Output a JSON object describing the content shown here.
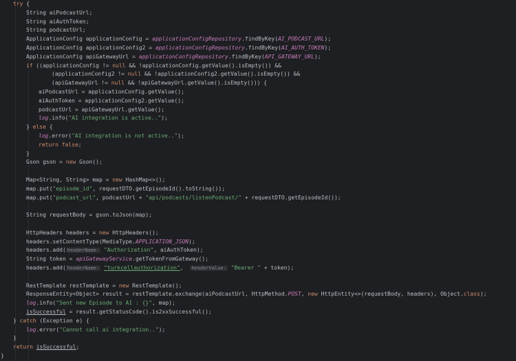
{
  "editor": {
    "lines": [
      {
        "x": 19,
        "tokens": [
          {
            "t": "try",
            "c": "kw"
          },
          {
            "t": " {",
            "c": ""
          }
        ]
      },
      {
        "x": 38,
        "tokens": [
          {
            "t": "String aiPodcastUrl;",
            "c": ""
          }
        ]
      },
      {
        "x": 38,
        "tokens": [
          {
            "t": "String aiAuthToken;",
            "c": ""
          }
        ]
      },
      {
        "x": 38,
        "tokens": [
          {
            "t": "String podcastUrl;",
            "c": ""
          }
        ]
      },
      {
        "x": 38,
        "tokens": [
          {
            "t": "ApplicationConfig applicationConfig = ",
            "c": ""
          },
          {
            "t": "applicationConfigRepository",
            "c": "fld"
          },
          {
            "t": ".findByKey(",
            "c": ""
          },
          {
            "t": "AI_PODCAST_URL",
            "c": "fld"
          },
          {
            "t": ");",
            "c": ""
          }
        ]
      },
      {
        "x": 38,
        "tokens": [
          {
            "t": "ApplicationConfig applicationConfig2 = ",
            "c": ""
          },
          {
            "t": "applicationConfigRepository",
            "c": "fld"
          },
          {
            "t": ".findByKey(",
            "c": ""
          },
          {
            "t": "AI_AUTH_TOKEN",
            "c": "fld"
          },
          {
            "t": ");",
            "c": ""
          }
        ]
      },
      {
        "x": 38,
        "tokens": [
          {
            "t": "ApplicationConfig apiGatewayUrl = ",
            "c": ""
          },
          {
            "t": "applicationConfigRepository",
            "c": "fld"
          },
          {
            "t": ".findByKey(",
            "c": ""
          },
          {
            "t": "API_GATEWAY_URL",
            "c": "fld"
          },
          {
            "t": ");",
            "c": ""
          }
        ]
      },
      {
        "x": 38,
        "tokens": [
          {
            "t": "if",
            "c": "kw"
          },
          {
            "t": " ((applicationConfig != ",
            "c": ""
          },
          {
            "t": "null",
            "c": "kw"
          },
          {
            "t": " && !applicationConfig.getValue().isEmpty()) &&",
            "c": ""
          }
        ]
      },
      {
        "x": 75,
        "tokens": [
          {
            "t": "(applicationConfig2 != ",
            "c": ""
          },
          {
            "t": "null",
            "c": "kw"
          },
          {
            "t": " && !applicationConfig2.getValue().isEmpty()) &&",
            "c": ""
          }
        ]
      },
      {
        "x": 75,
        "tokens": [
          {
            "t": "(apiGatewayUrl != ",
            "c": ""
          },
          {
            "t": "null",
            "c": "kw"
          },
          {
            "t": " && !apiGatewayUrl.getValue().isEmpty())) {",
            "c": ""
          }
        ]
      },
      {
        "x": 56,
        "tokens": [
          {
            "t": "aiPodcastUrl = applicationConfig.getValue();",
            "c": ""
          }
        ]
      },
      {
        "x": 56,
        "tokens": [
          {
            "t": "aiAuthToken = applicationConfig2.getValue();",
            "c": ""
          }
        ]
      },
      {
        "x": 56,
        "tokens": [
          {
            "t": "podcastUrl = apiGatewayUrl.getValue();",
            "c": ""
          }
        ]
      },
      {
        "x": 56,
        "tokens": [
          {
            "t": "log",
            "c": "fld"
          },
          {
            "t": ".info(",
            "c": ""
          },
          {
            "t": "\"AI integration is active..\"",
            "c": "str"
          },
          {
            "t": ");",
            "c": ""
          }
        ]
      },
      {
        "x": 38,
        "tokens": [
          {
            "t": "} ",
            "c": ""
          },
          {
            "t": "else",
            "c": "kw"
          },
          {
            "t": " {",
            "c": ""
          }
        ]
      },
      {
        "x": 56,
        "tokens": [
          {
            "t": "log",
            "c": "fld"
          },
          {
            "t": ".error(",
            "c": ""
          },
          {
            "t": "\"AI integration is not active..\"",
            "c": "str"
          },
          {
            "t": ");",
            "c": ""
          }
        ]
      },
      {
        "x": 56,
        "tokens": [
          {
            "t": "return false",
            "c": "kw"
          },
          {
            "t": ";",
            "c": ""
          }
        ]
      },
      {
        "x": 38,
        "tokens": [
          {
            "t": "}",
            "c": ""
          }
        ]
      },
      {
        "x": 38,
        "tokens": [
          {
            "t": "Gson gson = ",
            "c": ""
          },
          {
            "t": "new",
            "c": "kw"
          },
          {
            "t": " Gson();",
            "c": ""
          }
        ]
      },
      {
        "x": 38,
        "tokens": []
      },
      {
        "x": 38,
        "tokens": [
          {
            "t": "Map<String, String> map = ",
            "c": ""
          },
          {
            "t": "new",
            "c": "kw"
          },
          {
            "t": " HashMap<>();",
            "c": ""
          }
        ]
      },
      {
        "x": 38,
        "tokens": [
          {
            "t": "map.put(",
            "c": ""
          },
          {
            "t": "\"episode_id\"",
            "c": "str"
          },
          {
            "t": ", requestDTO.getEpisodeId().toString());",
            "c": ""
          }
        ]
      },
      {
        "x": 38,
        "tokens": [
          {
            "t": "map.put(",
            "c": ""
          },
          {
            "t": "\"podcast_url\"",
            "c": "str"
          },
          {
            "t": ", podcastUrl + ",
            "c": ""
          },
          {
            "t": "\"api/podcasts/listenPodcast/\"",
            "c": "str"
          },
          {
            "t": " + requestDTO.getEpisodeId());",
            "c": ""
          }
        ]
      },
      {
        "x": 38,
        "tokens": []
      },
      {
        "x": 38,
        "tokens": [
          {
            "t": "String requestBody = gson.toJson(map);",
            "c": ""
          }
        ]
      },
      {
        "x": 38,
        "tokens": []
      },
      {
        "x": 38,
        "tokens": [
          {
            "t": "HttpHeaders headers = ",
            "c": ""
          },
          {
            "t": "new",
            "c": "kw"
          },
          {
            "t": " HttpHeaders();",
            "c": ""
          }
        ]
      },
      {
        "x": 38,
        "tokens": [
          {
            "t": "headers.setContentType(MediaType.",
            "c": ""
          },
          {
            "t": "APPLICATION_JSON",
            "c": "fld"
          },
          {
            "t": ");",
            "c": ""
          }
        ]
      },
      {
        "x": 38,
        "tokens": [
          {
            "t": "headers.add(",
            "c": ""
          },
          {
            "t": "headerName:",
            "c": "hint"
          },
          {
            "t": " ",
            "c": ""
          },
          {
            "t": "\"Authorization\"",
            "c": "str"
          },
          {
            "t": ", aiAuthToken);",
            "c": ""
          }
        ]
      },
      {
        "x": 38,
        "tokens": [
          {
            "t": "String token = ",
            "c": ""
          },
          {
            "t": "apiGatewayService",
            "c": "fld"
          },
          {
            "t": ".getTokenFromGateway();",
            "c": ""
          }
        ]
      },
      {
        "x": 38,
        "tokens": [
          {
            "t": "headers.add(",
            "c": ""
          },
          {
            "t": "headerName:",
            "c": "hint"
          },
          {
            "t": " ",
            "c": ""
          },
          {
            "t": "\"turkcellauthorization\"",
            "c": "str uline"
          },
          {
            "t": ",  ",
            "c": ""
          },
          {
            "t": "headerValue:",
            "c": "hint"
          },
          {
            "t": " ",
            "c": ""
          },
          {
            "t": "\"Bearer \"",
            "c": "str"
          },
          {
            "t": " + token);",
            "c": ""
          }
        ]
      },
      {
        "x": 38,
        "tokens": []
      },
      {
        "x": 38,
        "tokens": [
          {
            "t": "RestTemplate restTemplate = ",
            "c": ""
          },
          {
            "t": "new",
            "c": "kw"
          },
          {
            "t": " RestTemplate();",
            "c": ""
          }
        ]
      },
      {
        "x": 38,
        "tokens": [
          {
            "t": "ResponseEntity<Object> result = restTemplate.exchange(aiPodcastUrl, HttpMethod.",
            "c": ""
          },
          {
            "t": "POST",
            "c": "fld"
          },
          {
            "t": ", ",
            "c": ""
          },
          {
            "t": "new",
            "c": "kw"
          },
          {
            "t": " HttpEntity<>(requestBody, headers), Object.",
            "c": ""
          },
          {
            "t": "class",
            "c": "kw"
          },
          {
            "t": ");",
            "c": ""
          }
        ]
      },
      {
        "x": 38,
        "tokens": [
          {
            "t": "log",
            "c": "fld"
          },
          {
            "t": ".info(",
            "c": ""
          },
          {
            "t": "\"Sent new Episode to AI : {}\"",
            "c": "str"
          },
          {
            "t": ", map);",
            "c": ""
          }
        ]
      },
      {
        "x": 38,
        "tokens": [
          {
            "t": "isSuccessful",
            "c": "uline"
          },
          {
            "t": " = result.getStatusCode().is2xxSuccessful();",
            "c": ""
          }
        ]
      },
      {
        "x": 19,
        "tokens": [
          {
            "t": "} ",
            "c": ""
          },
          {
            "t": "catch",
            "c": "kw"
          },
          {
            "t": " (Exception e) {",
            "c": ""
          }
        ]
      },
      {
        "x": 38,
        "tokens": [
          {
            "t": "log",
            "c": "fld"
          },
          {
            "t": ".error(",
            "c": ""
          },
          {
            "t": "\"Cannot call ai integration..\"",
            "c": "str"
          },
          {
            "t": ");",
            "c": ""
          }
        ]
      },
      {
        "x": 19,
        "tokens": [
          {
            "t": "}",
            "c": ""
          }
        ]
      },
      {
        "x": 19,
        "tokens": [
          {
            "t": "return",
            "c": "kw"
          },
          {
            "t": " ",
            "c": ""
          },
          {
            "t": "isSuccessful",
            "c": "uline"
          },
          {
            "t": ";",
            "c": ""
          }
        ]
      },
      {
        "x": 1,
        "tokens": [
          {
            "t": "}",
            "c": ""
          }
        ]
      }
    ]
  }
}
